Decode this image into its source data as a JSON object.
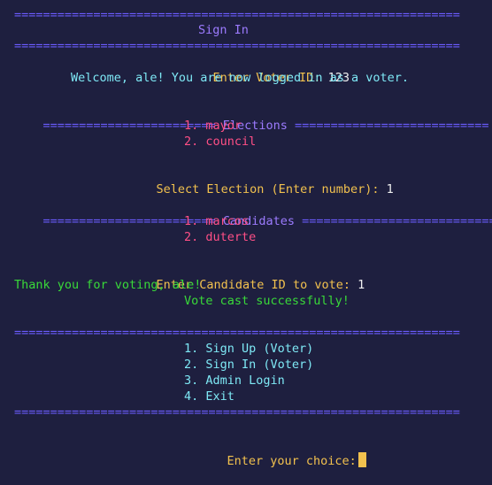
{
  "header_rule": "==============================================================",
  "title": "Sign In",
  "login": {
    "voter_id_prompt": "Enter Voter ID:",
    "voter_id_value": "123",
    "welcome_msg": "Welcome, ale! You are now logged in as a voter."
  },
  "elections": {
    "header_left": "========================",
    "header_label": "Elections",
    "header_right": "===========================",
    "items": [
      "1. mayor",
      "2. council"
    ],
    "select_prompt": "Select Election (Enter number):",
    "select_value": "1"
  },
  "candidates": {
    "header_left": "========================",
    "header_label": "Candidates",
    "header_right": "===========================",
    "items": [
      "1. marcos",
      "2. duterte"
    ],
    "vote_prompt": "Enter Candidate ID to vote:",
    "vote_value": "1",
    "thanks_msg": "Thank you for voting, ale!",
    "success_msg": "Vote cast successfully!"
  },
  "menu": {
    "items": [
      "1. Sign Up (Voter)",
      "2. Sign In (Voter)",
      "3. Admin Login",
      "4. Exit"
    ]
  },
  "choice_prompt": "Enter your choice:",
  "colors": {
    "background": "#1e1f3f",
    "rule": "#6b5cff",
    "heading": "#9c7bff",
    "prompt": "#f2c14e",
    "info": "#7ee8f5",
    "list": "#ff4f86",
    "success": "#39d939"
  }
}
